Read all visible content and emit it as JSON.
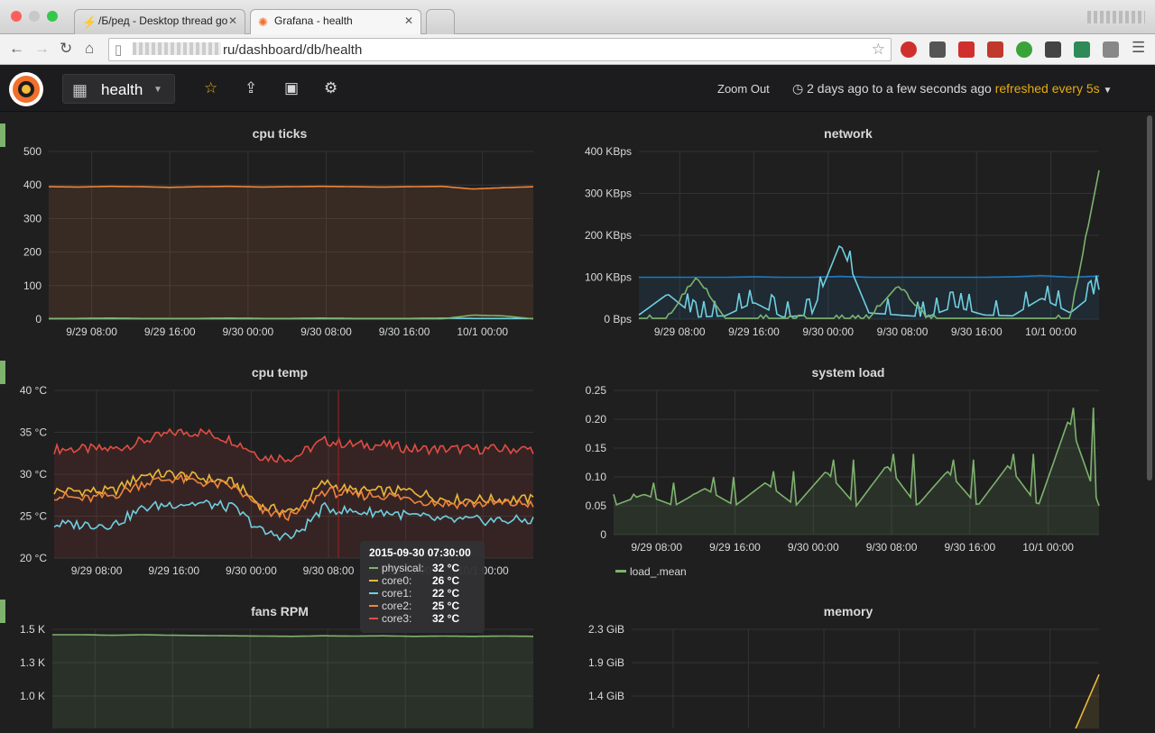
{
  "browser": {
    "tabs": [
      {
        "title": "/Б/ред - Desktop thread go",
        "icon": "lightning-icon"
      },
      {
        "title": "Grafana - health",
        "icon": "grafana-icon"
      }
    ],
    "url_suffix": "ru/dashboard/db/health"
  },
  "grafana": {
    "dashboard_name": "health",
    "zoom_out": "Zoom Out",
    "time_range": "2 days ago to a few seconds ago",
    "refresh": "refreshed every 5s",
    "accent": "#e5ac0e"
  },
  "tooltip": {
    "time": "2015-09-30 07:30:00",
    "rows": [
      {
        "label": "physical:",
        "value": "32 °C",
        "color": "#7eb26d"
      },
      {
        "label": "core0:",
        "value": "26 °C",
        "color": "#eab839"
      },
      {
        "label": "core1:",
        "value": "22 °C",
        "color": "#6ed0e0"
      },
      {
        "label": "core2:",
        "value": "25 °C",
        "color": "#ef843c"
      },
      {
        "label": "core3:",
        "value": "32 °C",
        "color": "#e24d42"
      }
    ]
  },
  "chart_data": [
    {
      "title": "cpu ticks",
      "type": "line",
      "x_ticks": [
        "9/29 08:00",
        "9/29 16:00",
        "9/30 00:00",
        "9/30 08:00",
        "9/30 16:00",
        "10/1 00:00"
      ],
      "y_ticks": [
        "500",
        "400",
        "300",
        "200",
        "100",
        "0"
      ],
      "ylim": [
        0,
        500
      ],
      "series": [
        {
          "color": "#ef843c",
          "values": [
            395,
            394,
            396,
            395,
            393,
            395,
            396,
            394,
            395,
            396,
            395,
            394,
            395,
            396,
            388,
            392,
            395
          ]
        },
        {
          "color": "#6ed0e0",
          "values": [
            2,
            2,
            3,
            2,
            2,
            2,
            3,
            2,
            2,
            3,
            2,
            2,
            2,
            3,
            2,
            2,
            2
          ]
        },
        {
          "color": "#7eb26d",
          "values": [
            1,
            1,
            1,
            1,
            1,
            1,
            1,
            1,
            1,
            1,
            1,
            1,
            1,
            1,
            12,
            10,
            1
          ]
        }
      ]
    },
    {
      "title": "network",
      "type": "line",
      "x_ticks": [
        "9/29 08:00",
        "9/29 16:00",
        "9/30 00:00",
        "9/30 08:00",
        "9/30 16:00",
        "10/1 00:00"
      ],
      "y_ticks": [
        "400 KBps",
        "300 KBps",
        "200 KBps",
        "100 KBps",
        "0 Bps"
      ],
      "ylim": [
        0,
        400
      ],
      "series": [
        {
          "color": "#1f78c1",
          "values": [
            100,
            100,
            100,
            100,
            101,
            100,
            100,
            102,
            100,
            100,
            100,
            100,
            100,
            101,
            104,
            100,
            103
          ]
        },
        {
          "color": "#6ed0e0",
          "values": [
            10,
            60,
            5,
            8,
            40,
            5,
            10,
            180,
            15,
            10,
            5,
            30,
            10,
            8,
            50,
            15,
            70
          ]
        },
        {
          "color": "#7eb26d",
          "values": [
            2,
            2,
            100,
            2,
            2,
            2,
            2,
            2,
            2,
            80,
            2,
            2,
            2,
            2,
            2,
            2,
            355
          ]
        }
      ]
    },
    {
      "title": "cpu temp",
      "type": "line",
      "x_ticks": [
        "9/29 08:00",
        "9/29 16:00",
        "9/30 00:00",
        "9/30 08:00",
        "9/30 16:00",
        "10/1 00:00"
      ],
      "y_ticks": [
        "40 °C",
        "35 °C",
        "30 °C",
        "25 °C",
        "20 °C"
      ],
      "ylim": [
        20,
        40
      ],
      "series": [
        {
          "name": "core3",
          "color": "#e24d42",
          "values": [
            33,
            33,
            33,
            34,
            35,
            35,
            34,
            32,
            32,
            34,
            33.5,
            33.5,
            33,
            33,
            33,
            33,
            33
          ]
        },
        {
          "name": "core0",
          "color": "#eab839",
          "values": [
            28,
            28,
            28,
            30,
            30,
            29.5,
            29,
            26,
            25.5,
            29,
            28,
            28,
            28,
            27,
            27,
            27,
            27
          ]
        },
        {
          "name": "core2",
          "color": "#ef843c",
          "values": [
            27.5,
            27,
            27.5,
            29,
            29.5,
            29,
            28.5,
            25.5,
            25,
            28,
            27.5,
            27.5,
            27,
            26.5,
            26.5,
            26.5,
            26.5
          ]
        },
        {
          "name": "core1",
          "color": "#6ed0e0",
          "values": [
            24,
            24,
            24,
            26,
            26.5,
            26.5,
            26,
            23,
            22.5,
            26,
            25.5,
            25.5,
            25,
            24.5,
            24.5,
            24.5,
            24.5
          ]
        }
      ]
    },
    {
      "title": "system load",
      "type": "line",
      "x_ticks": [
        "9/29 08:00",
        "9/29 16:00",
        "9/30 00:00",
        "9/30 08:00",
        "9/30 16:00",
        "10/1 00:00"
      ],
      "y_ticks": [
        "0.25",
        "0.20",
        "0.15",
        "0.10",
        "0.05",
        "0"
      ],
      "ylim": [
        0,
        0.25
      ],
      "legend": [
        "load_.mean"
      ],
      "series": [
        {
          "name": "load_.mean",
          "color": "#7eb26d",
          "values": [
            0.05,
            0.07,
            0.05,
            0.08,
            0.05,
            0.09,
            0.05,
            0.11,
            0.05,
            0.12,
            0.05,
            0.11,
            0.05,
            0.12,
            0.05,
            0.2,
            0.05
          ]
        }
      ]
    },
    {
      "title": "fans RPM",
      "type": "line",
      "y_ticks": [
        "1.5 K",
        "1.3 K",
        "1.0 K"
      ],
      "ylim": [
        1000,
        1500
      ],
      "series": [
        {
          "color": "#7eb26d",
          "values": [
            1480,
            1480,
            1478,
            1480,
            1478,
            1477,
            1476,
            1475,
            1474,
            1476,
            1475,
            1476,
            1474,
            1475,
            1474,
            1475,
            1474
          ]
        }
      ]
    },
    {
      "title": "memory",
      "type": "line",
      "y_ticks": [
        "2.3 GiB",
        "1.9 GiB",
        "1.4 GiB"
      ],
      "ylim": [
        1.4,
        2.3
      ],
      "series": [
        {
          "color": "#eab839",
          "values": [
            1.4,
            1.41,
            1.42,
            1.43,
            1.44,
            1.45,
            1.46,
            1.47,
            1.48,
            1.49,
            1.5,
            1.51,
            1.52,
            1.53,
            1.54,
            1.55,
            2.0
          ]
        }
      ]
    }
  ]
}
